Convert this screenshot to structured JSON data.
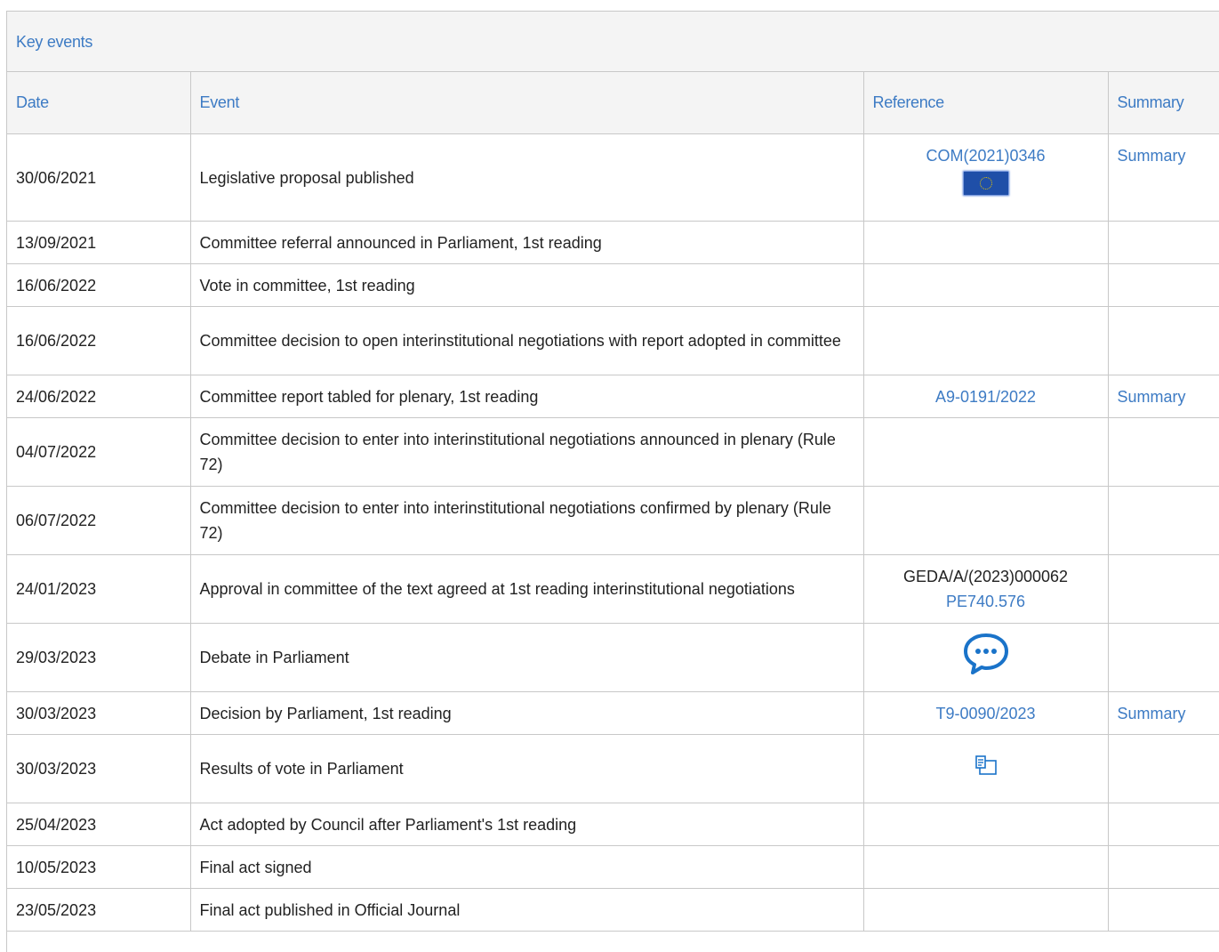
{
  "panel": {
    "title": "Key events"
  },
  "columns": {
    "date": "Date",
    "event": "Event",
    "reference": "Reference",
    "summary": "Summary"
  },
  "rows": [
    {
      "date": "30/06/2021",
      "event": "Legislative proposal published",
      "reference": "COM(2021)0346",
      "reference_icon": "eu-flag-icon",
      "summary": "Summary"
    },
    {
      "date": "13/09/2021",
      "event": "Committee referral announced in Parliament, 1st reading"
    },
    {
      "date": "16/06/2022",
      "event": "Vote in committee, 1st reading"
    },
    {
      "date": "16/06/2022",
      "event": "Committee decision to open interinstitutional negotiations with report adopted in committee"
    },
    {
      "date": "24/06/2022",
      "event": "Committee report tabled for plenary, 1st reading",
      "reference": "A9-0191/2022",
      "summary": "Summary"
    },
    {
      "date": "04/07/2022",
      "event": "Committee decision to enter into interinstitutional negotiations announced in plenary (Rule 72)"
    },
    {
      "date": "06/07/2022",
      "event": "Committee decision to enter into interinstitutional negotiations confirmed by plenary (Rule 72)"
    },
    {
      "date": "24/01/2023",
      "event": "Approval in committee of the text agreed at 1st reading interinstitutional negotiations",
      "reference_text": "GEDA/A/(2023)000062",
      "reference": "PE740.576"
    },
    {
      "date": "29/03/2023",
      "event": "Debate in Parliament",
      "reference_icon": "speech-bubble-icon"
    },
    {
      "date": "30/03/2023",
      "event": "Decision by Parliament, 1st reading",
      "reference": "T9-0090/2023",
      "summary": "Summary"
    },
    {
      "date": "30/03/2023",
      "event": "Results of vote in Parliament",
      "reference_icon": "vote-ballot-icon"
    },
    {
      "date": "25/04/2023",
      "event": "Act adopted by Council after Parliament's 1st reading"
    },
    {
      "date": "10/05/2023",
      "event": "Final act signed"
    },
    {
      "date": "23/05/2023",
      "event": "Final act published in Official Journal"
    }
  ],
  "colors": {
    "link": "#3d7bc4",
    "header_bg": "#f4f4f4",
    "border": "#c8c8c8"
  }
}
